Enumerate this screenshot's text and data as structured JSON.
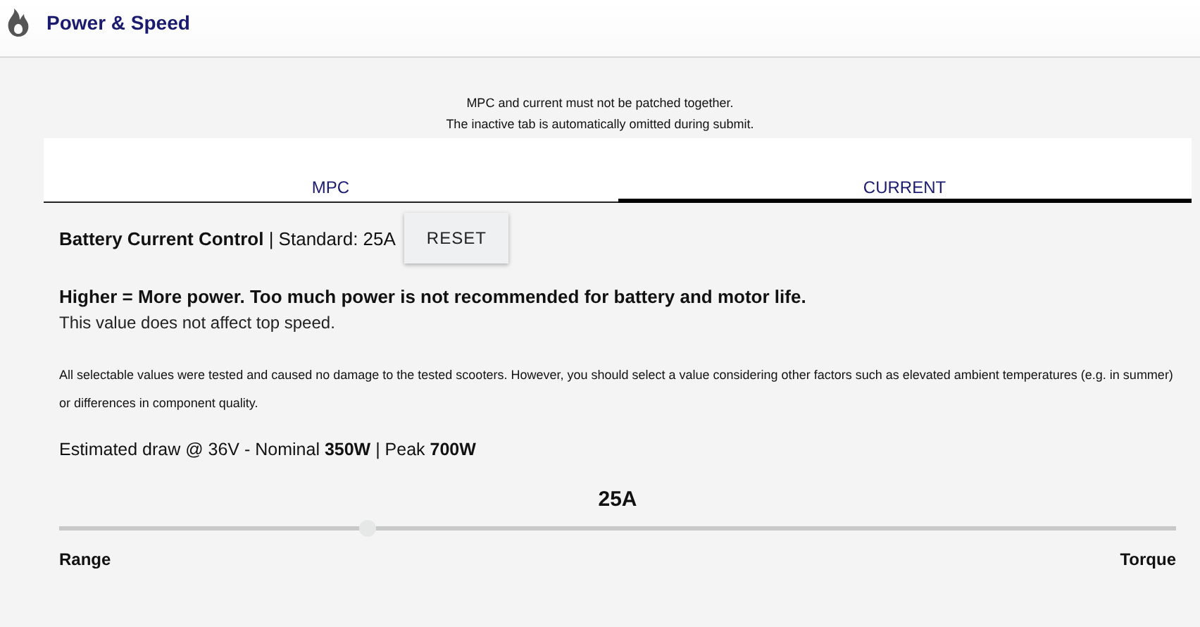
{
  "header": {
    "title": "Power & Speed"
  },
  "notes": [
    "MPC and current must not be patched together.",
    "The inactive tab is automatically omitted during submit."
  ],
  "tabs": [
    {
      "label": "MPC",
      "selected": false
    },
    {
      "label": "CURRENT",
      "selected": true
    }
  ],
  "setting": {
    "title": "Battery Current Control",
    "standard": "| Standard: 25A",
    "reset_button": "RESET"
  },
  "warning": "Higher = More power. Too much power is not recommended for battery and motor life.",
  "info": "This value does not affect top speed.",
  "disclaimer": "All selectable values were tested and caused no damage to the tested scooters. However, you should select a value considering other factors such as elevated ambient temperatures (e.g. in summer) or differences in component quality.",
  "estimate": "Estimated draw @ 36V - Nominal **350W** | Peak **700W**",
  "slider": {
    "value": "25A",
    "level": 0.276,
    "min_label": "Range",
    "max_label": "Torque"
  }
}
